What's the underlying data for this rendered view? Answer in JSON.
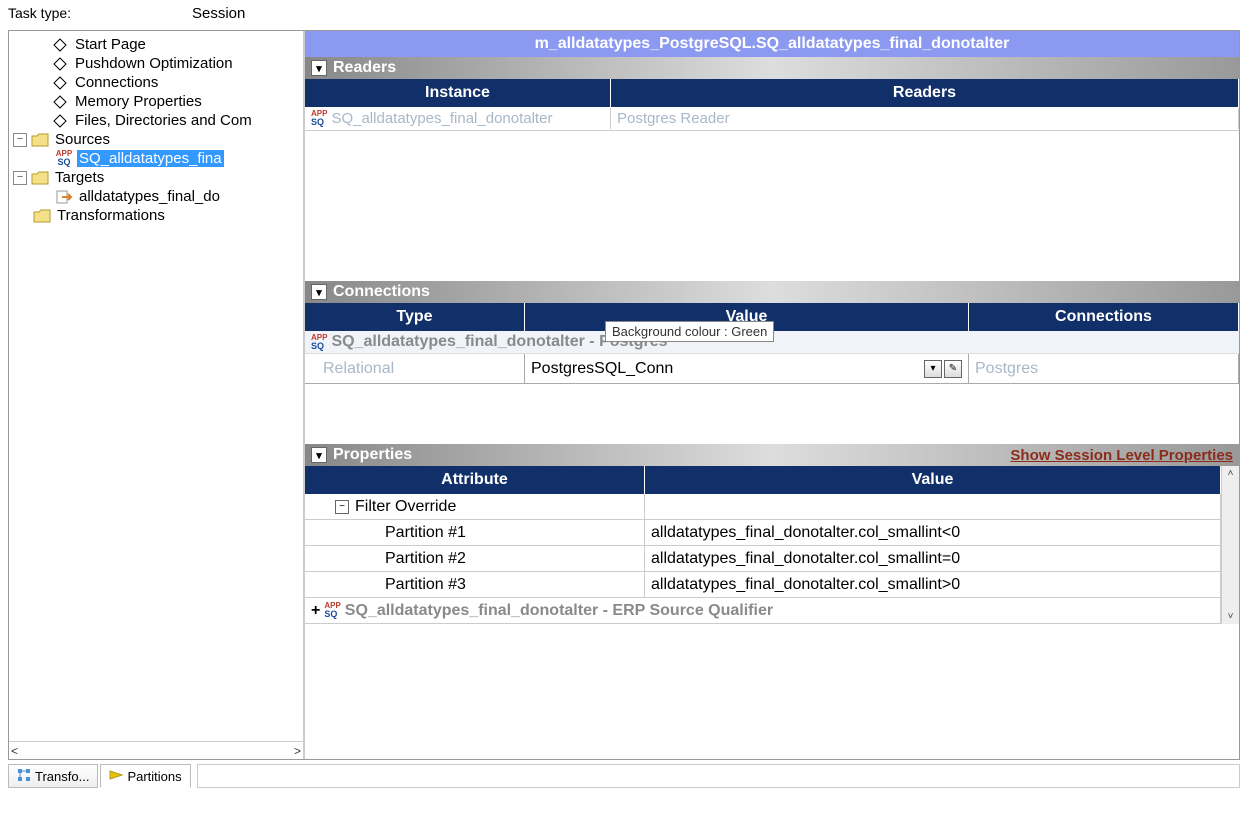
{
  "task_type_label": "Task type:",
  "task_type_value": "Session",
  "tree": {
    "nodes": [
      {
        "kind": "diamond",
        "label": "Start Page",
        "sel": false
      },
      {
        "kind": "diamond",
        "label": "Pushdown Optimization",
        "sel": false
      },
      {
        "kind": "diamond",
        "label": "Connections",
        "sel": false
      },
      {
        "kind": "diamond",
        "label": "Memory Properties",
        "sel": false
      },
      {
        "kind": "diamond",
        "label": "Files, Directories and Com",
        "sel": false
      }
    ],
    "sources_label": "Sources",
    "source_child": "SQ_alldatatypes_fina",
    "targets_label": "Targets",
    "target_child": "alldatatypes_final_do",
    "transformations_label": "Transformations"
  },
  "tabs": {
    "transfo": "Transfo...",
    "partitions": "Partitions"
  },
  "title": "m_alldatatypes_PostgreSQL.SQ_alldatatypes_final_donotalter",
  "readers": {
    "header": "Readers",
    "cols": {
      "instance": "Instance",
      "readers": "Readers"
    },
    "rows": [
      {
        "instance": "SQ_alldatatypes_final_donotalter",
        "readers": "Postgres Reader"
      }
    ]
  },
  "connections": {
    "header": "Connections",
    "cols": {
      "type": "Type",
      "value": "Value",
      "connections": "Connections"
    },
    "group": "SQ_alldatatypes_final_donotalter - Postgres",
    "row": {
      "type": "Relational",
      "value": "PostgresSQL_Conn",
      "connections": "Postgres"
    }
  },
  "tooltip": "Background colour : Green",
  "properties": {
    "header": "Properties",
    "link": "Show Session Level Properties",
    "cols": {
      "attr": "Attribute",
      "value": "Value"
    },
    "group": "Filter Override",
    "rows": [
      {
        "attr": "Partition #1",
        "value": "alldatatypes_final_donotalter.col_smallint<0"
      },
      {
        "attr": "Partition #2",
        "value": "alldatatypes_final_donotalter.col_smallint=0"
      },
      {
        "attr": "Partition #3",
        "value": "alldatatypes_final_donotalter.col_smallint>0"
      }
    ],
    "footer": "SQ_alldatatypes_final_donotalter - ERP Source Qualifier"
  }
}
